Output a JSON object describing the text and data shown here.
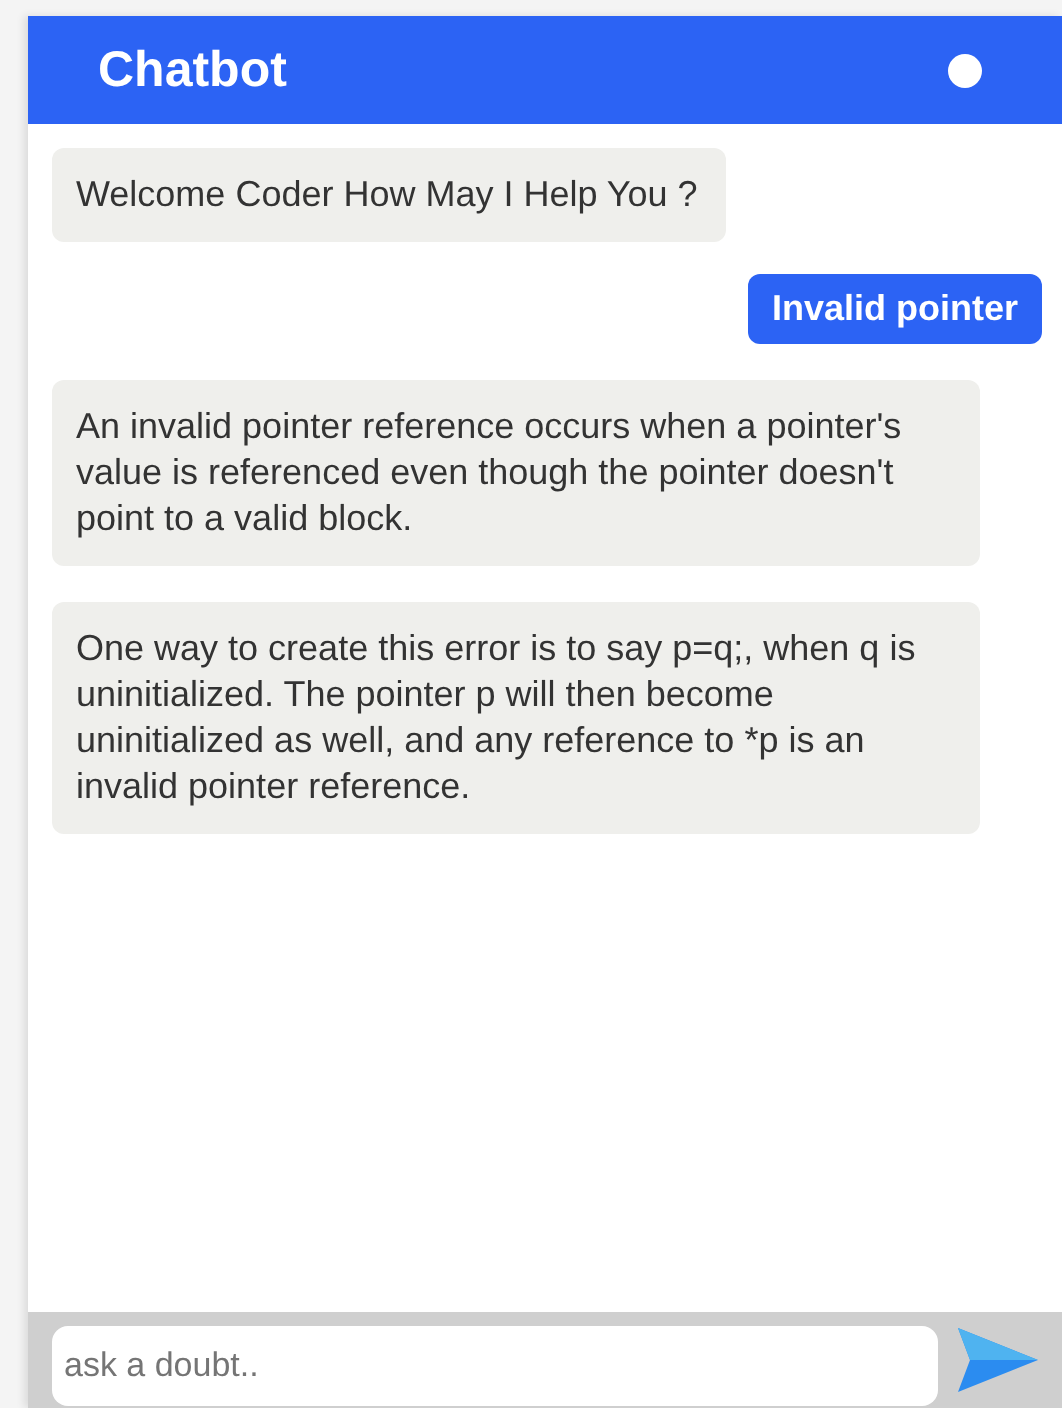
{
  "header": {
    "title": "Chatbot"
  },
  "messages": [
    {
      "kind": "bot",
      "text": "Welcome Coder How May I Help You ?"
    },
    {
      "kind": "user",
      "text": "Invalid pointer"
    },
    {
      "kind": "bot",
      "text": "An invalid pointer reference occurs when a pointer's value is referenced even though the pointer doesn't point to a valid block."
    },
    {
      "kind": "bot",
      "text": "One way to create this error is to say p=q;, when q is uninitialized. The pointer p will then become uninitialized as well, and any reference to *p is an invalid pointer reference."
    }
  ],
  "composer": {
    "placeholder": "ask a doubt.."
  }
}
